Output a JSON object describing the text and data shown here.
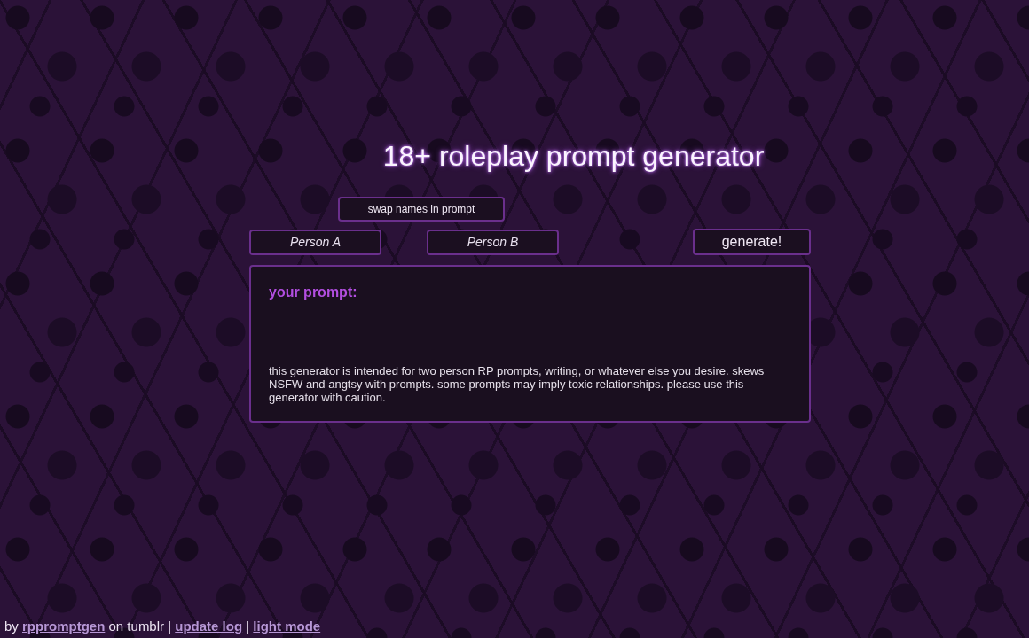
{
  "title": "18+ roleplay prompt generator",
  "swap_button": "swap names in prompt",
  "name_fields": [
    {
      "placeholder": "Person A"
    },
    {
      "placeholder": "Person B"
    }
  ],
  "generate_button": "generate!",
  "prompt_panel": {
    "heading": "your prompt:",
    "disclaimer": "this generator is intended for two person RP prompts, writing, or whatever else you desire. skews NSFW and angtsy with prompts. some prompts may imply toxic relationships. please use this generator with caution."
  },
  "footer": [
    {
      "kind": "text",
      "text": "by"
    },
    {
      "kind": "link",
      "text": "rppromptgen"
    },
    {
      "kind": "text",
      "text": "on tumblr |"
    },
    {
      "kind": "link",
      "text": "update log"
    },
    {
      "kind": "text",
      "text": "|"
    },
    {
      "kind": "link",
      "text": "light mode"
    }
  ]
}
